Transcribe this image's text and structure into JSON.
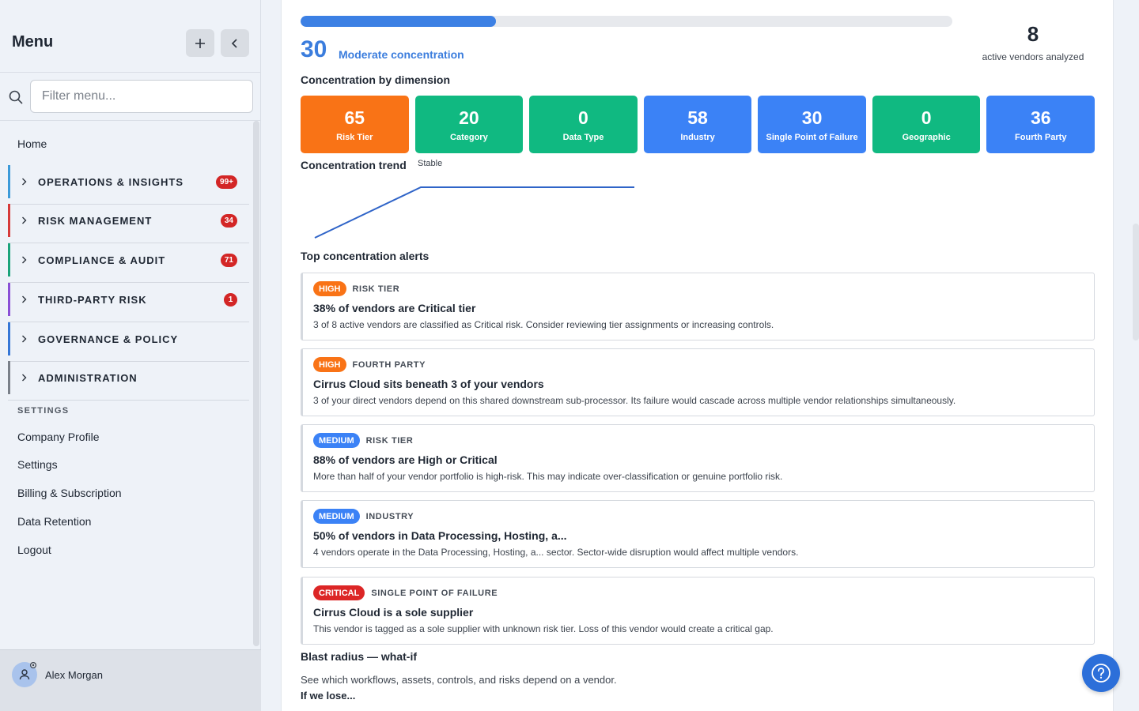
{
  "sidebar": {
    "title": "Menu",
    "search_placeholder": "Filter menu...",
    "home": "Home",
    "groups": [
      {
        "label": "OPERATIONS & INSIGHTS",
        "badge": "99+",
        "accent": "#3b9ad9"
      },
      {
        "label": "RISK MANAGEMENT",
        "badge": "34",
        "accent": "#d63a3a"
      },
      {
        "label": "COMPLIANCE & AUDIT",
        "badge": "71",
        "accent": "#1aa37a"
      },
      {
        "label": "THIRD-PARTY RISK",
        "badge": "1",
        "accent": "#8a4fd6"
      },
      {
        "label": "GOVERNANCE & POLICY",
        "badge": "",
        "accent": "#3576d6"
      },
      {
        "label": "ADMINISTRATION",
        "badge": "",
        "accent": "#7a8089"
      }
    ],
    "settings_heading": "SETTINGS",
    "settings_items": [
      "Company Profile",
      "Settings",
      "Billing & Subscription",
      "Data Retention",
      "Logout"
    ],
    "user_name": "Alex Morgan"
  },
  "main": {
    "progress_fraction": 0.3,
    "score": "30",
    "score_label": "Moderate concentration",
    "vendors_count": "8",
    "vendors_label": "active vendors analyzed",
    "dimension_heading": "Concentration by dimension",
    "dimensions": [
      {
        "value": "65",
        "label": "Risk Tier",
        "color": "#f97316"
      },
      {
        "value": "20",
        "label": "Category",
        "color": "#10b981"
      },
      {
        "value": "0",
        "label": "Data Type",
        "color": "#10b981"
      },
      {
        "value": "58",
        "label": "Industry",
        "color": "#3b82f6"
      },
      {
        "value": "30",
        "label": "Single Point of Failure",
        "color": "#3b82f6"
      },
      {
        "value": "0",
        "label": "Geographic",
        "color": "#10b981"
      },
      {
        "value": "36",
        "label": "Fourth Party",
        "color": "#3b82f6"
      }
    ],
    "trend_heading": "Concentration trend",
    "trend_status": "Stable",
    "alerts_heading": "Top concentration alerts",
    "alerts": [
      {
        "severity": "HIGH",
        "sev_color": "#f97316",
        "dimension": "RISK TIER",
        "title": "38% of vendors are Critical tier",
        "description": "3 of 8 active vendors are classified as Critical risk. Consider reviewing tier assignments or increasing controls."
      },
      {
        "severity": "HIGH",
        "sev_color": "#f97316",
        "dimension": "FOURTH PARTY",
        "title": "Cirrus Cloud sits beneath 3 of your vendors",
        "description": "3 of your direct vendors depend on this shared downstream sub-processor. Its failure would cascade across multiple vendor relationships simultaneously."
      },
      {
        "severity": "MEDIUM",
        "sev_color": "#3b82f6",
        "dimension": "RISK TIER",
        "title": "88% of vendors are High or Critical",
        "description": "More than half of your vendor portfolio is high-risk. This may indicate over-classification or genuine portfolio risk."
      },
      {
        "severity": "MEDIUM",
        "sev_color": "#3b82f6",
        "dimension": "INDUSTRY",
        "title": "50% of vendors in Data Processing, Hosting, a...",
        "description": "4 vendors operate in the Data Processing, Hosting, a... sector. Sector-wide disruption would affect multiple vendors."
      },
      {
        "severity": "CRITICAL",
        "sev_color": "#dc2626",
        "dimension": "SINGLE POINT OF FAILURE",
        "title": "Cirrus Cloud is a sole supplier",
        "description": "This vendor is tagged as a sole supplier with unknown risk tier. Loss of this vendor would create a critical gap."
      }
    ],
    "blast_heading": "Blast radius — what-if",
    "blast_description": "See which workflows, assets, controls, and risks depend on a vendor.",
    "blast_lose": "If we lose..."
  }
}
